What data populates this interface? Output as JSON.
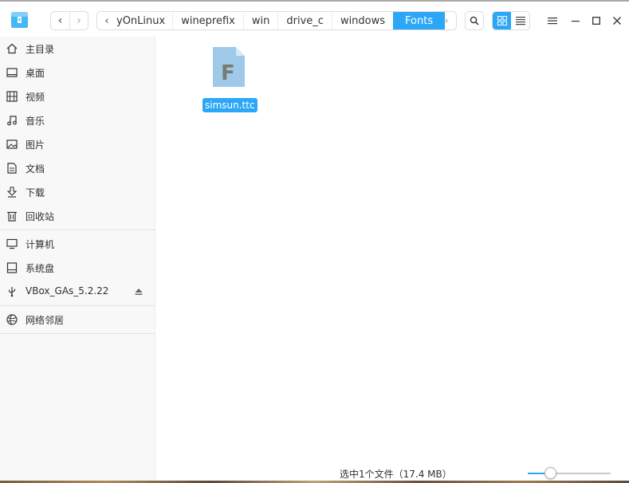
{
  "window": {
    "colors": {
      "accent": "#2ca7f8",
      "sidebar_bg": "#f8f8f8"
    }
  },
  "toolbar": {
    "back_icon": "chevron-left-icon",
    "forward_icon": "chevron-right-icon",
    "breadcrumbs": [
      "yOnLinux",
      "wineprefix",
      "win",
      "drive_c",
      "windows",
      "Fonts"
    ],
    "active_crumb": "Fonts",
    "search_icon": "search-icon",
    "view_modes": [
      "icon-view",
      "list-view"
    ],
    "active_view": "icon-view",
    "window_controls": [
      "menu-icon",
      "minimize-icon",
      "maximize-icon",
      "close-icon"
    ]
  },
  "sidebar": {
    "items": [
      {
        "label": "主目录",
        "icon": "home-icon"
      },
      {
        "label": "桌面",
        "icon": "desktop-icon"
      },
      {
        "label": "视频",
        "icon": "video-icon"
      },
      {
        "label": "音乐",
        "icon": "music-icon"
      },
      {
        "label": "图片",
        "icon": "picture-icon"
      },
      {
        "label": "文档",
        "icon": "document-icon"
      },
      {
        "label": "下载",
        "icon": "download-icon"
      },
      {
        "label": "回收站",
        "icon": "trash-icon"
      }
    ],
    "devices": [
      {
        "label": "计算机",
        "icon": "computer-icon"
      },
      {
        "label": "系统盘",
        "icon": "disk-icon"
      },
      {
        "label": "VBox_GAs_5.2.22",
        "icon": "usb-icon",
        "ejectable": true
      }
    ],
    "network": [
      {
        "label": "网络邻居",
        "icon": "network-icon"
      }
    ]
  },
  "files": [
    {
      "name": "simsun.ttc",
      "icon": "font-file-icon",
      "icon_letter": "F",
      "selected": true
    }
  ],
  "status": {
    "text": "选中1个文件（17.4 MB）",
    "zoom_level": 0.25
  }
}
